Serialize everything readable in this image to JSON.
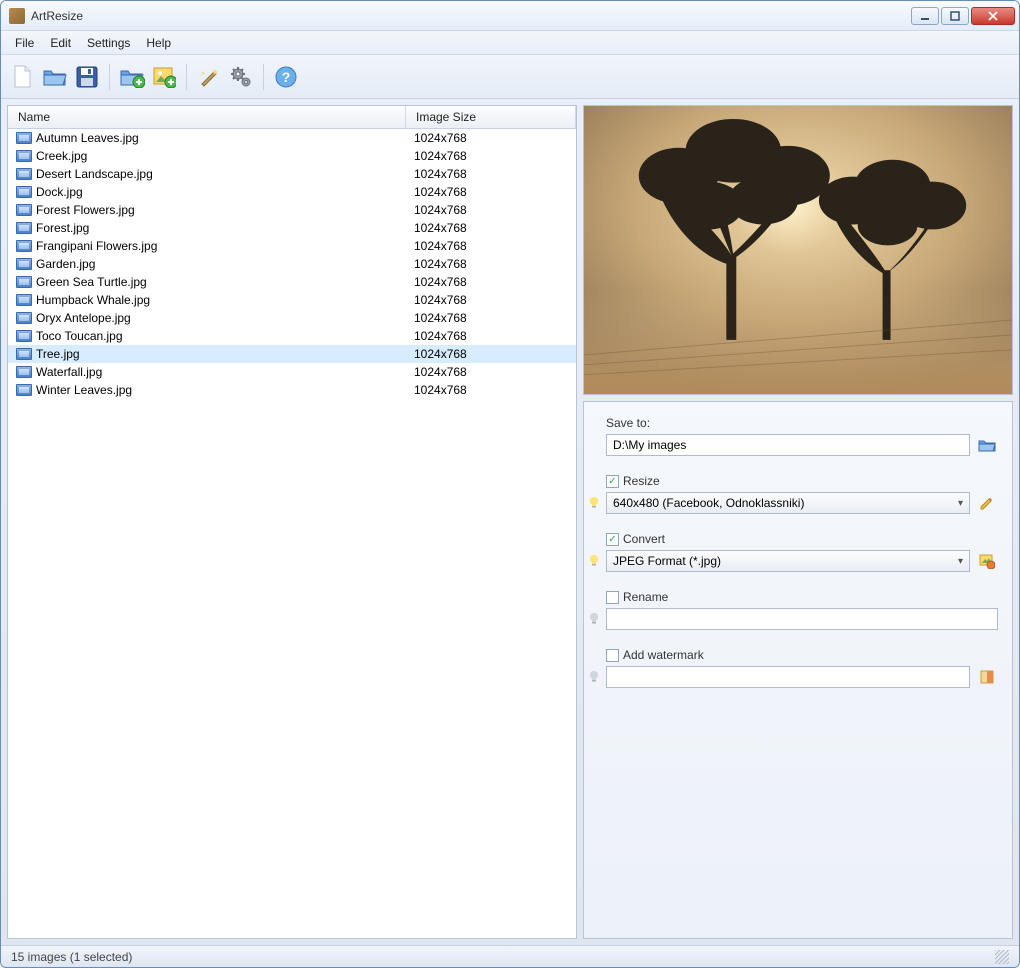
{
  "window": {
    "title": "ArtResize"
  },
  "menu": {
    "items": [
      "File",
      "Edit",
      "Settings",
      "Help"
    ]
  },
  "toolbar": {
    "icons": [
      "new-file-icon",
      "open-folder-icon",
      "save-icon",
      "add-folder-icon",
      "add-image-icon",
      "effects-icon",
      "settings-icon",
      "help-icon"
    ]
  },
  "list": {
    "columns": {
      "name": "Name",
      "size": "Image Size"
    },
    "selected_index": 12,
    "rows": [
      {
        "name": "Autumn Leaves.jpg",
        "size": "1024x768"
      },
      {
        "name": "Creek.jpg",
        "size": "1024x768"
      },
      {
        "name": "Desert Landscape.jpg",
        "size": "1024x768"
      },
      {
        "name": "Dock.jpg",
        "size": "1024x768"
      },
      {
        "name": "Forest Flowers.jpg",
        "size": "1024x768"
      },
      {
        "name": "Forest.jpg",
        "size": "1024x768"
      },
      {
        "name": "Frangipani Flowers.jpg",
        "size": "1024x768"
      },
      {
        "name": "Garden.jpg",
        "size": "1024x768"
      },
      {
        "name": "Green Sea Turtle.jpg",
        "size": "1024x768"
      },
      {
        "name": "Humpback Whale.jpg",
        "size": "1024x768"
      },
      {
        "name": "Oryx Antelope.jpg",
        "size": "1024x768"
      },
      {
        "name": "Toco Toucan.jpg",
        "size": "1024x768"
      },
      {
        "name": "Tree.jpg",
        "size": "1024x768"
      },
      {
        "name": "Waterfall.jpg",
        "size": "1024x768"
      },
      {
        "name": "Winter Leaves.jpg",
        "size": "1024x768"
      }
    ]
  },
  "options": {
    "save_to_label": "Save to:",
    "save_to_value": "D:\\My images",
    "resize": {
      "checked": true,
      "label": "Resize",
      "value": "640x480 (Facebook, Odnoklassniki)"
    },
    "convert": {
      "checked": true,
      "label": "Convert",
      "value": "JPEG Format (*.jpg)"
    },
    "rename": {
      "checked": false,
      "label": "Rename",
      "value": ""
    },
    "watermark": {
      "checked": false,
      "label": "Add watermark",
      "value": ""
    }
  },
  "status": {
    "text": "15 images (1 selected)"
  }
}
